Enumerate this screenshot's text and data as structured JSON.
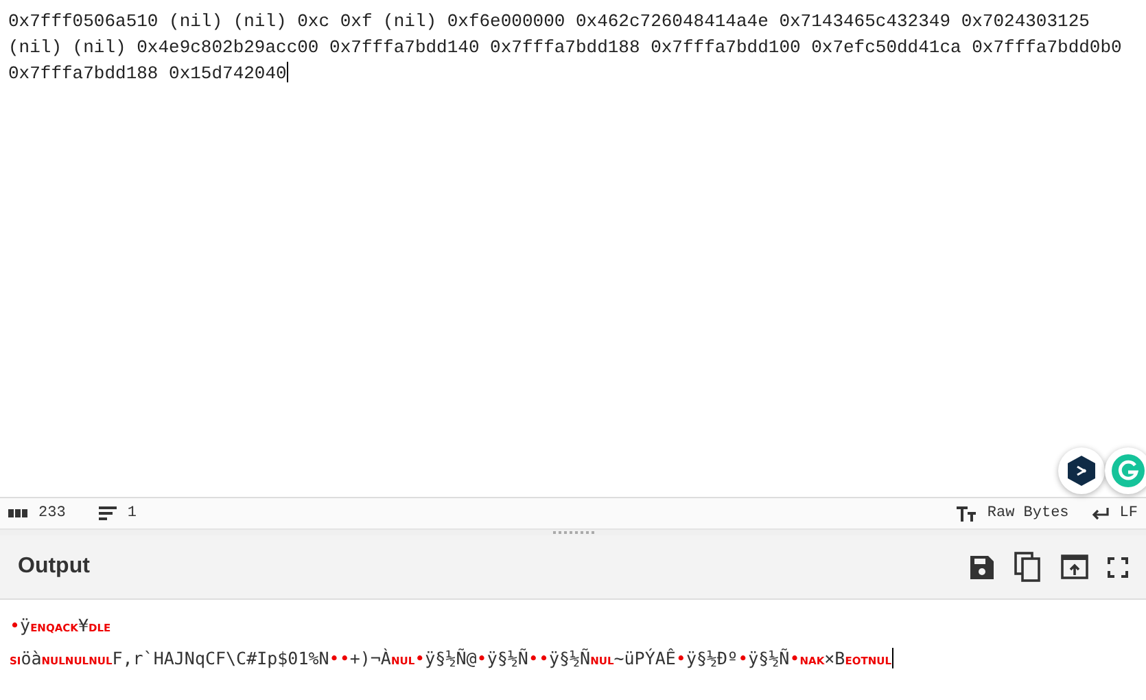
{
  "input": {
    "text": "0x7fff0506a510 (nil) (nil) 0xc 0xf (nil) 0xf6e000000 0x462c726048414a4e 0x7143465c432349 0x7024303125 (nil) (nil) 0x4e9c802b29acc00 0x7fffa7bdd140 0x7fffa7bdd188 0x7fffa7bdd100 0x7efc50dd41ca 0x7fffa7bdd0b0 0x7fffa7bdd188 0x15d742040"
  },
  "status_bar": {
    "length": "233",
    "lines": "1",
    "encoding": "Raw Bytes",
    "eol": "LF"
  },
  "output": {
    "title": "Output",
    "lines": [
      [
        {
          "kind": "dot",
          "text": "•"
        },
        {
          "kind": "text",
          "text": "ÿ"
        },
        {
          "kind": "control",
          "text": "ENQ"
        },
        {
          "kind": "control",
          "text": "ACK"
        },
        {
          "kind": "text",
          "text": "¥"
        },
        {
          "kind": "control",
          "text": "DLE"
        }
      ],
      [
        {
          "kind": "control",
          "text": "SI"
        },
        {
          "kind": "text",
          "text": "öà"
        },
        {
          "kind": "control",
          "text": "NUL"
        },
        {
          "kind": "control",
          "text": "NUL"
        },
        {
          "kind": "control",
          "text": "NUL"
        },
        {
          "kind": "text",
          "text": "F,r`HAJNqCF\\C#Ip$01%N"
        },
        {
          "kind": "dot",
          "text": "•"
        },
        {
          "kind": "dot",
          "text": "•"
        },
        {
          "kind": "text",
          "text": "+)¬À"
        },
        {
          "kind": "control",
          "text": "NUL"
        },
        {
          "kind": "dot",
          "text": "•"
        },
        {
          "kind": "text",
          "text": "ÿ§½Ñ@"
        },
        {
          "kind": "dot",
          "text": "•"
        },
        {
          "kind": "text",
          "text": "ÿ§½Ñ"
        },
        {
          "kind": "dot",
          "text": "•"
        },
        {
          "kind": "dot",
          "text": "•"
        },
        {
          "kind": "text",
          "text": "ÿ§½Ñ"
        },
        {
          "kind": "control",
          "text": "NUL"
        },
        {
          "kind": "text",
          "text": "~üPÝAÊ"
        },
        {
          "kind": "dot",
          "text": "•"
        },
        {
          "kind": "text",
          "text": "ÿ§½Ðº"
        },
        {
          "kind": "dot",
          "text": "•"
        },
        {
          "kind": "text",
          "text": "ÿ§½Ñ"
        },
        {
          "kind": "dot",
          "text": "•"
        },
        {
          "kind": "control",
          "text": "NAK"
        },
        {
          "kind": "text",
          "text": "×B"
        },
        {
          "kind": "control",
          "text": "EOT"
        },
        {
          "kind": "control",
          "text": "NUL"
        }
      ]
    ]
  }
}
